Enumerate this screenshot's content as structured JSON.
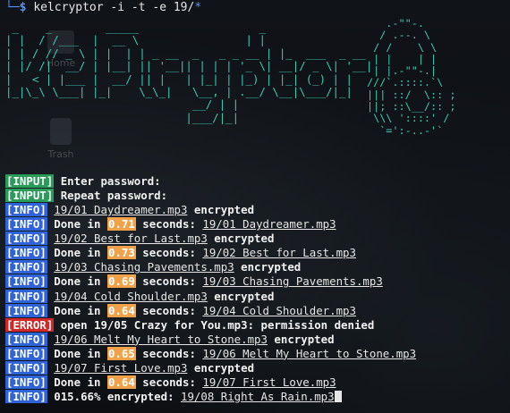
{
  "prompt": {
    "corner": "└─",
    "dollar": "$",
    "command": "kelcryptor",
    "args": " -i -t -e 19/",
    "glob": "*"
  },
  "banner": {
    "logo": " _    _        _____                  _             \n| |  / /___  |  __ \\                | |            \n| | / // _ \\ | |  | | _ __  _   _ _ __ | |_  ___  _ __\n| |/ /|  __/ | |__| || '__|| | | | '_ \\| __|/ _ \\| '__|\n|   < | |___ |  __/ || |   | |_| | |_) | |_| (_) | |\n|_|\\_\\ \\___| |_|    \\_\\_|   \\__, | .__/ \\__|\\___/|_|\n                            __/ | |\n                           |___/|_|",
    "lock": "   .-\"\"-.\n  / .--. \\\n / /    \\ \\\n | |    | |\n | |.-\"\"-.|\n///`.::::.`\\\n||| ::/  \\:: ;\n||; ::\\__/:: ;\n \\\\\\ '::::' /\n  `=':-..-'`"
  },
  "desktop_icons": [
    {
      "label": "Home"
    },
    {
      "label": "Trash"
    }
  ],
  "log": [
    {
      "tag": "INPUT",
      "parts": [
        {
          "t": "msg",
          "v": "Enter password:"
        }
      ]
    },
    {
      "tag": "INPUT",
      "parts": [
        {
          "t": "msg",
          "v": "Repeat password:"
        }
      ]
    },
    {
      "tag": "INFO",
      "parts": [
        {
          "t": "file",
          "v": "19/01 Daydreamer.mp3"
        },
        {
          "t": "msg",
          "v": " encrypted"
        }
      ]
    },
    {
      "tag": "INFO",
      "parts": [
        {
          "t": "msg",
          "v": "Done in "
        },
        {
          "t": "secs",
          "v": "0.71"
        },
        {
          "t": "msg",
          "v": " seconds: "
        },
        {
          "t": "file",
          "v": "19/01 Daydreamer.mp3"
        }
      ]
    },
    {
      "tag": "INFO",
      "parts": [
        {
          "t": "file",
          "v": "19/02 Best for Last.mp3"
        },
        {
          "t": "msg",
          "v": " encrypted"
        }
      ]
    },
    {
      "tag": "INFO",
      "parts": [
        {
          "t": "msg",
          "v": "Done in "
        },
        {
          "t": "secs",
          "v": "0.73"
        },
        {
          "t": "msg",
          "v": " seconds: "
        },
        {
          "t": "file",
          "v": "19/02 Best for Last.mp3"
        }
      ]
    },
    {
      "tag": "INFO",
      "parts": [
        {
          "t": "file",
          "v": "19/03 Chasing Pavements.mp3"
        },
        {
          "t": "msg",
          "v": " encrypted"
        }
      ]
    },
    {
      "tag": "INFO",
      "parts": [
        {
          "t": "msg",
          "v": "Done in "
        },
        {
          "t": "secs",
          "v": "0.69"
        },
        {
          "t": "msg",
          "v": " seconds: "
        },
        {
          "t": "file",
          "v": "19/03 Chasing Pavements.mp3"
        }
      ]
    },
    {
      "tag": "INFO",
      "parts": [
        {
          "t": "file",
          "v": "19/04 Cold Shoulder.mp3"
        },
        {
          "t": "msg",
          "v": " encrypted"
        }
      ]
    },
    {
      "tag": "INFO",
      "parts": [
        {
          "t": "msg",
          "v": "Done in "
        },
        {
          "t": "secs",
          "v": "0.64"
        },
        {
          "t": "msg",
          "v": " seconds: "
        },
        {
          "t": "file",
          "v": "19/04 Cold Shoulder.mp3"
        }
      ]
    },
    {
      "tag": "ERROR",
      "parts": [
        {
          "t": "msg",
          "v": "open 19/05 Crazy for You.mp3: permission denied"
        }
      ]
    },
    {
      "tag": "INFO",
      "parts": [
        {
          "t": "file",
          "v": "19/06 Melt My Heart to Stone.mp3"
        },
        {
          "t": "msg",
          "v": " encrypted"
        }
      ]
    },
    {
      "tag": "INFO",
      "parts": [
        {
          "t": "msg",
          "v": "Done in "
        },
        {
          "t": "secs",
          "v": "0.65"
        },
        {
          "t": "msg",
          "v": " seconds: "
        },
        {
          "t": "file",
          "v": "19/06 Melt My Heart to Stone.mp3"
        }
      ]
    },
    {
      "tag": "INFO",
      "parts": [
        {
          "t": "file",
          "v": "19/07 First Love.mp3"
        },
        {
          "t": "msg",
          "v": " encrypted"
        }
      ]
    },
    {
      "tag": "INFO",
      "parts": [
        {
          "t": "msg",
          "v": "Done in "
        },
        {
          "t": "secs",
          "v": "0.64"
        },
        {
          "t": "msg",
          "v": " seconds: "
        },
        {
          "t": "file",
          "v": "19/07 First Love.mp3"
        }
      ]
    },
    {
      "tag": "INFO",
      "parts": [
        {
          "t": "msg",
          "v": "015.66% encrypted: "
        },
        {
          "t": "file",
          "v": "19/08 Right As Rain.mp3"
        }
      ],
      "cursor": true
    }
  ],
  "colors": {
    "background": "#0d0f12",
    "banner": "#3cc9b4",
    "input_tag": "#2a9c5a",
    "info_tag": "#2f63d8",
    "error_tag": "#d02828",
    "seconds_highlight": "#f0a24a",
    "prompt": "#4e93ff"
  }
}
